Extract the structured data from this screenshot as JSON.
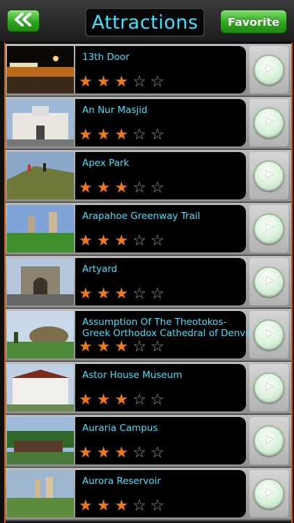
{
  "header": {
    "title": "Attractions",
    "favorite_label": "Favorite"
  },
  "colors": {
    "accent_cyan": "#38e4ff",
    "star_orange": "#f07a1a",
    "button_green": "#2fa51e"
  },
  "list": {
    "rating_max": 5,
    "items": [
      {
        "name": "13th Door",
        "rating": 3
      },
      {
        "name": "An Nur Masjid",
        "rating": 3
      },
      {
        "name": "Apex Park",
        "rating": 3
      },
      {
        "name": "Arapahoe Greenway Trail",
        "rating": 3
      },
      {
        "name": "Artyard",
        "rating": 3
      },
      {
        "name": "Assumption Of The Theotokos- Greek Orthodox Cathedral of Denver",
        "rating": 3
      },
      {
        "name": "Astor House Museum",
        "rating": 3
      },
      {
        "name": "Auraria Campus",
        "rating": 3
      },
      {
        "name": "Aurora Reservoir",
        "rating": 3
      }
    ]
  },
  "icons": {
    "back": "double-chevron-left-icon",
    "go": "play-arrow-icon",
    "star": "star-icon"
  }
}
